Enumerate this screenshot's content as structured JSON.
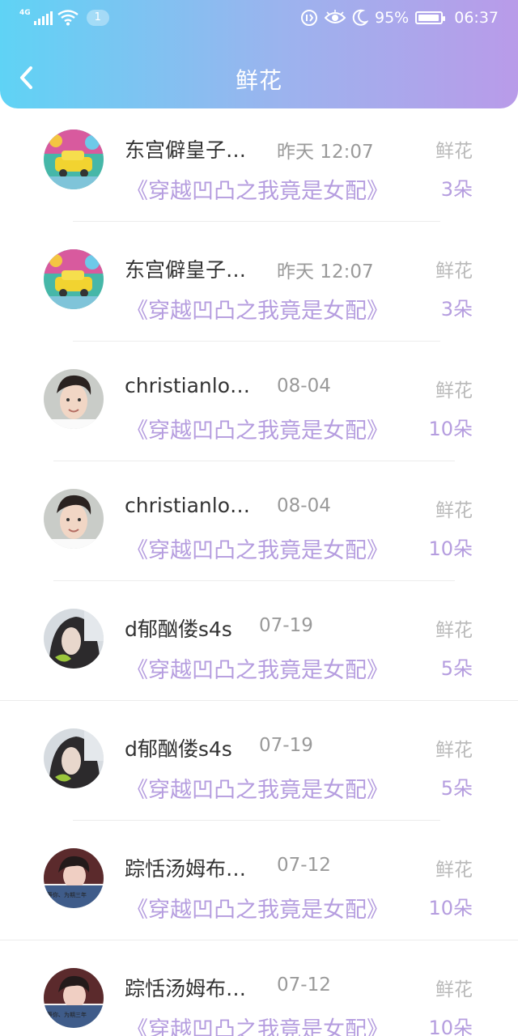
{
  "status_bar": {
    "network": "4G",
    "notification_count": "1",
    "battery": "95%",
    "time": "06:37",
    "battery_level": 0.95
  },
  "nav": {
    "title": "鲜花"
  },
  "records": [
    {
      "name": "东宫僻皇子…",
      "time": "昨天 12:07",
      "type": "鲜花",
      "book": "《穿越凹凸之我竟是女配》",
      "count": "3朵",
      "avatar": "yellow-car"
    },
    {
      "name": "东宫僻皇子…",
      "time": "昨天 12:07",
      "type": "鲜花",
      "book": "《穿越凹凸之我竟是女配》",
      "count": "3朵",
      "avatar": "yellow-car"
    },
    {
      "name": "christianlo…",
      "time": "08-04",
      "type": "鲜花",
      "book": "《穿越凹凸之我竟是女配》",
      "count": "10朵",
      "avatar": "young-man"
    },
    {
      "name": "christianlo…",
      "time": "08-04",
      "type": "鲜花",
      "book": "《穿越凹凸之我竟是女配》",
      "count": "10朵",
      "avatar": "young-man"
    },
    {
      "name": "d郁酗偻s4s",
      "time": "07-19",
      "type": "鲜花",
      "book": "《穿越凹凸之我竟是女配》",
      "count": "5朵",
      "avatar": "girl-with-leaf"
    },
    {
      "name": "d郁酗偻s4s",
      "time": "07-19",
      "type": "鲜花",
      "book": "《穿越凹凸之我竟是女配》",
      "count": "5朵",
      "avatar": "girl-with-leaf"
    },
    {
      "name": "踪恬汤姆布…",
      "time": "07-12",
      "type": "鲜花",
      "book": "《穿越凹凸之我竟是女配》",
      "count": "10朵",
      "avatar": "girl-with-caption"
    },
    {
      "name": "踪恬汤姆布…",
      "time": "07-12",
      "type": "鲜花",
      "book": "《穿越凹凸之我竟是女配》",
      "count": "10朵",
      "avatar": "girl-with-caption"
    }
  ],
  "avatar_caption": "等你、为期三年"
}
